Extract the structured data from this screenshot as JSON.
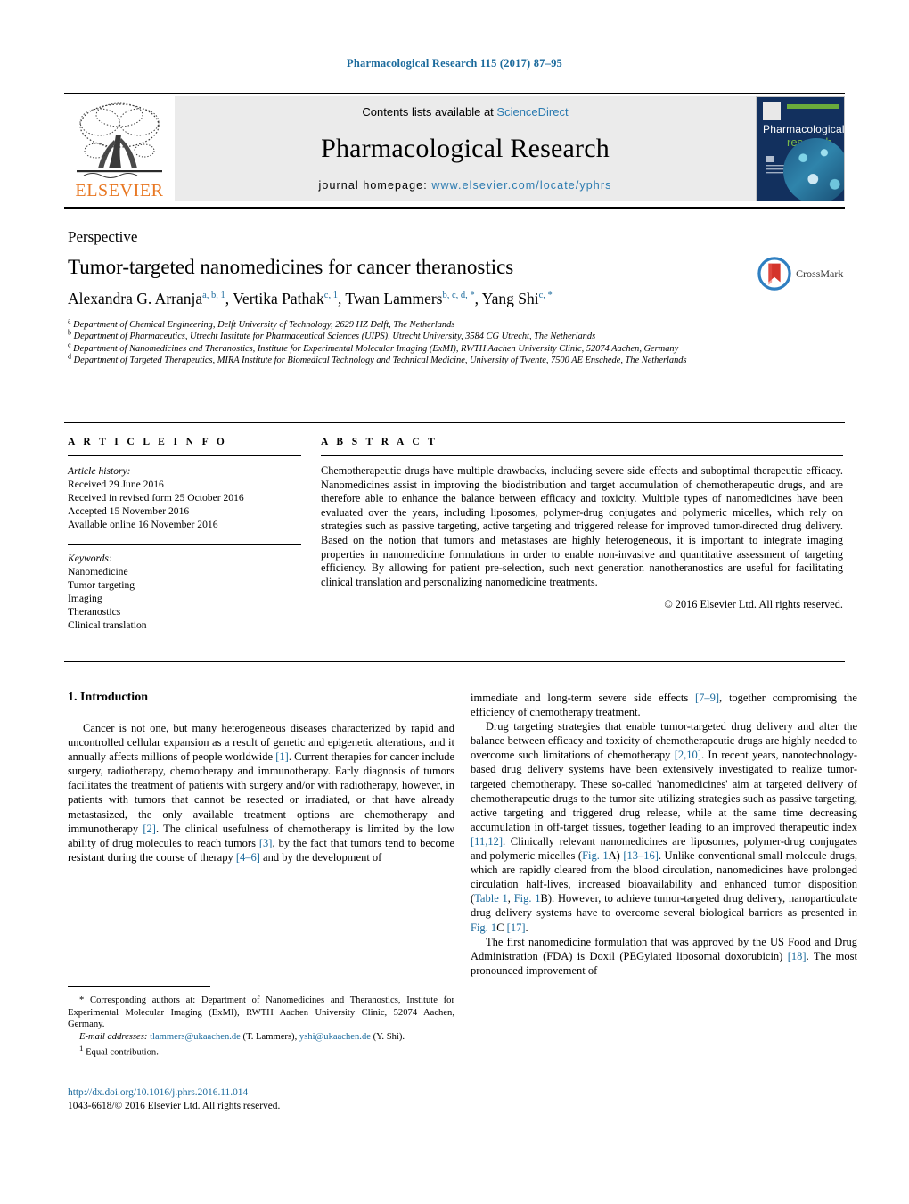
{
  "running_head": "Pharmacological Research 115 (2017) 87–95",
  "masthead": {
    "publisher_name": "ELSEVIER",
    "contents_prefix": "Contents lists available at ",
    "contents_link": "ScienceDirect",
    "journal_title": "Pharmacological Research",
    "homepage_prefix": "journal homepage: ",
    "homepage_url": "www.elsevier.com/locate/yphrs",
    "cover": {
      "line1": "Pharmacological",
      "line2": "research"
    }
  },
  "article": {
    "type_label": "Perspective",
    "title": "Tumor-targeted nanomedicines for cancer theranostics",
    "crossmark_label": "CrossMark",
    "authors": [
      {
        "name": "Alexandra G. Arranja",
        "marks": "a, b, 1"
      },
      {
        "name": "Vertika Pathak",
        "marks": "c, 1"
      },
      {
        "name": "Twan Lammers",
        "marks": "b, c, d, *"
      },
      {
        "name": "Yang Shi",
        "marks": "c, *"
      }
    ],
    "affiliations": [
      {
        "mark": "a",
        "text": "Department of Chemical Engineering, Delft University of Technology, 2629 HZ Delft, The Netherlands"
      },
      {
        "mark": "b",
        "text": "Department of Pharmaceutics, Utrecht Institute for Pharmaceutical Sciences (UIPS), Utrecht University, 3584 CG Utrecht, The Netherlands"
      },
      {
        "mark": "c",
        "text": "Department of Nanomedicines and Theranostics, Institute for Experimental Molecular Imaging (ExMI), RWTH Aachen University Clinic, 52074 Aachen, Germany"
      },
      {
        "mark": "d",
        "text": "Department of Targeted Therapeutics, MIRA Institute for Biomedical Technology and Technical Medicine, University of Twente, 7500 AE Enschede, The Netherlands"
      }
    ]
  },
  "article_info": {
    "heading": "A R T I C L E   I N F O",
    "history_label": "Article history:",
    "history": [
      "Received 29 June 2016",
      "Received in revised form 25 October 2016",
      "Accepted 15 November 2016",
      "Available online 16 November 2016"
    ],
    "keywords_label": "Keywords:",
    "keywords": [
      "Nanomedicine",
      "Tumor targeting",
      "Imaging",
      "Theranostics",
      "Clinical translation"
    ]
  },
  "abstract": {
    "heading": "A B S T R A C T",
    "text": "Chemotherapeutic drugs have multiple drawbacks, including severe side effects and suboptimal therapeutic efficacy. Nanomedicines assist in improving the biodistribution and target accumulation of chemotherapeutic drugs, and are therefore able to enhance the balance between efficacy and toxicity. Multiple types of nanomedicines have been evaluated over the years, including liposomes, polymer-drug conjugates and polymeric micelles, which rely on strategies such as passive targeting, active targeting and triggered release for improved tumor-directed drug delivery. Based on the notion that tumors and metastases are highly heterogeneous, it is important to integrate imaging properties in nanomedicine formulations in order to enable non-invasive and quantitative assessment of targeting efficiency. By allowing for patient pre-selection, such next generation nanotheranostics are useful for facilitating clinical translation and personalizing nanomedicine treatments.",
    "copyright": "© 2016 Elsevier Ltd. All rights reserved."
  },
  "body": {
    "section_heading": "1.  Introduction",
    "left_paragraphs": [
      "Cancer is not one, but many heterogeneous diseases characterized by rapid and uncontrolled cellular expansion as a result of genetic and epigenetic alterations, and it annually affects millions of people worldwide [1]. Current therapies for cancer include surgery, radiotherapy, chemotherapy and immunotherapy. Early diagnosis of tumors facilitates the treatment of patients with surgery and/or with radiotherapy, however, in patients with tumors that cannot be resected or irradiated, or that have already metastasized, the only available treatment options are chemotherapy and immunotherapy [2]. The clinical usefulness of chemotherapy is limited by the low ability of drug molecules to reach tumors [3], by the fact that tumors tend to become resistant during the course of therapy [4–6] and by the development of"
    ],
    "right_paragraphs": [
      "immediate and long-term severe side effects [7–9], together compromising the efficiency of chemotherapy treatment.",
      "Drug targeting strategies that enable tumor-targeted drug delivery and alter the balance between efficacy and toxicity of chemotherapeutic drugs are highly needed to overcome such limitations of chemotherapy [2,10]. In recent years, nanotechnology-based drug delivery systems have been extensively investigated to realize tumor-targeted chemotherapy. These so-called 'nanomedicines' aim at targeted delivery of chemotherapeutic drugs to the tumor site utilizing strategies such as passive targeting, active targeting and triggered drug release, while at the same time decreasing accumulation in off-target tissues, together leading to an improved therapeutic index [11,12]. Clinically relevant nanomedicines are liposomes, polymer-drug conjugates and polymeric micelles (Fig. 1A) [13–16]. Unlike conventional small molecule drugs, which are rapidly cleared from the blood circulation, nanomedicines have prolonged circulation half-lives, increased bioavailability and enhanced tumor disposition (Table 1, Fig. 1B). However, to achieve tumor-targeted drug delivery, nanoparticulate drug delivery systems have to overcome several biological barriers as presented in Fig. 1C [17].",
      "The first nanomedicine formulation that was approved by the US Food and Drug Administration (FDA) is Doxil (PEGylated liposomal doxorubicin) [18]. The most pronounced improvement of"
    ]
  },
  "footnotes": {
    "corresponding": "Corresponding authors at: Department of Nanomedicines and Theranostics, Institute for Experimental Molecular Imaging (ExMI), RWTH Aachen University Clinic, 52074 Aachen, Germany.",
    "email_label": "E-mail addresses:",
    "email_1": "tlammers@ukaachen.de",
    "email_1_owner": "(T. Lammers)",
    "email_2": "yshi@ukaachen.de",
    "email_2_owner": "(Y. Shi).",
    "equal_contribution_mark": "1",
    "equal_contribution": "Equal contribution."
  },
  "doi_block": {
    "doi_url": "http://dx.doi.org/10.1016/j.phrs.2016.11.014",
    "issn_line": "1043-6618/© 2016 Elsevier Ltd. All rights reserved."
  }
}
